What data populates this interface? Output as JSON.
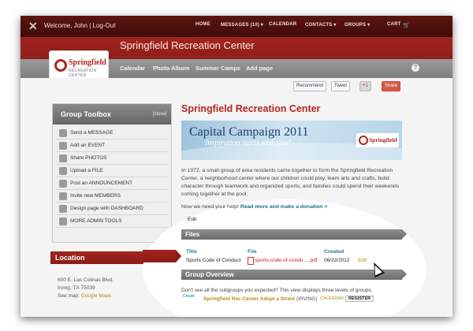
{
  "topbar": {
    "welcome": "Welcome, John | Log-Out",
    "nav": [
      {
        "label": "HOME"
      },
      {
        "label": "MESSAGES (10) ▾"
      },
      {
        "label": "CALENDAR"
      },
      {
        "label": "CONTACTS ▾"
      },
      {
        "label": "GROUPS ▾"
      },
      {
        "label": "CART"
      }
    ]
  },
  "header": {
    "site_title": "Springfield Recreation Center",
    "brand_name": "Springfield",
    "brand_sub": "RECREATION CENTER"
  },
  "subnav": [
    {
      "label": "Calendar"
    },
    {
      "label": "Photo Album"
    },
    {
      "label": "Summer Camps"
    },
    {
      "label": "Add page"
    }
  ],
  "share": {
    "recommend": "Recommend",
    "tweet": "Tweet",
    "plus": "+1",
    "share": "Share"
  },
  "toolbox": {
    "title": "Group Toolbox",
    "close": "[close]",
    "items": [
      {
        "label": "Send a MESSAGE"
      },
      {
        "label": "Add an EVENT"
      },
      {
        "label": "Share PHOTOS"
      },
      {
        "label": "Upload a FILE"
      },
      {
        "label": "Post an ANNOUNCEMENT"
      },
      {
        "label": "Invite new MEMBERS"
      },
      {
        "label": "Design page with DASHBOARD"
      },
      {
        "label": "MORE ADMIN TOOLS"
      }
    ]
  },
  "location": {
    "title": "Location",
    "line1": "600 E. Las Colinas Blvd.",
    "line2": "Irving, TX 75039",
    "map_prefix": "See map:",
    "map_link": "Google Maps"
  },
  "main": {
    "title": "Springfield Recreation Center",
    "banner_title": "Capital Campaign 2011",
    "banner_sub": "Inspiration starts with you!",
    "banner_logo": "Springfield",
    "intro": "In 1972, a small group of area residents came together to form the Springfield Recreation Center, a neighborhood center where our children could play, learn arts and crafts, build character through teamwork and organized sports, and families could spend their weekends coming together at the pool.",
    "help_prefix": "Now we need your help!",
    "help_link": "Read more and make a donation >",
    "edit": "Edit"
  },
  "files": {
    "title": "Files",
    "columns": [
      "Title",
      "File",
      "Created"
    ],
    "rows": [
      {
        "title": "Sports Code of Conduct",
        "file": "sports-code-of-condu.....pdf",
        "created": "06/22/2012",
        "edit": "Edit"
      }
    ]
  },
  "overview": {
    "title": "Group Overview",
    "text": "Don't see all the subgroups you expected? This view displays three levels of groups.",
    "create": "Create",
    "group_name": "Springfield Rec Center Adopt a Street",
    "group_city": "(IRVING)",
    "calendar": "CALENDAR",
    "register": "REGISTER"
  }
}
